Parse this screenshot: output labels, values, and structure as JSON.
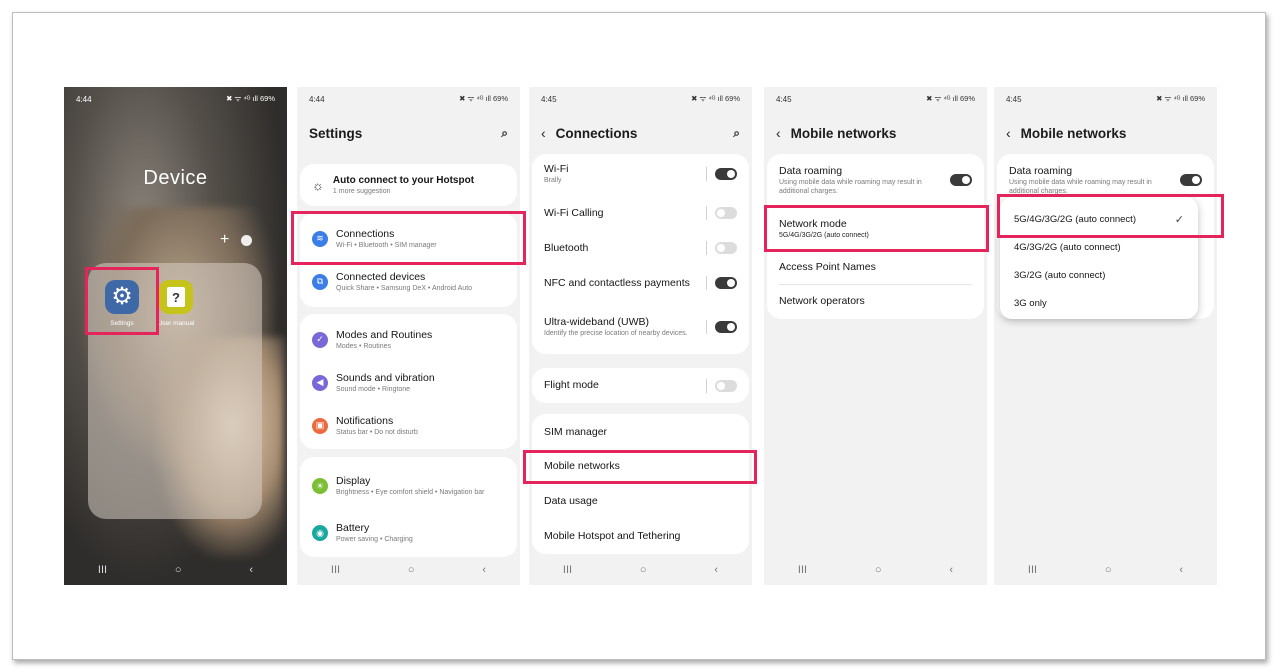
{
  "phone1": {
    "time": "4:44",
    "status_icons": "✖ ᯤ ⁴ᴳ ıll 69%",
    "folder_title": "Device",
    "add": "+",
    "apps": [
      {
        "label": "Settings",
        "icon": "gear-icon",
        "glyph": "⚙"
      },
      {
        "label": "User manual",
        "icon": "question-icon",
        "glyph": "?"
      }
    ]
  },
  "phone2": {
    "time": "4:44",
    "status_icons": "✖ ᯤ ⁴ᴳ ıll 69%",
    "title": "Settings",
    "search_glyph": "⌕",
    "suggestion": {
      "title": "Auto connect to your Hotspot",
      "subtitle": "1 more suggestion",
      "glyph": "☼"
    },
    "items": [
      {
        "title": "Connections",
        "subtitle": "Wi-Fi  •  Bluetooth  •  SIM manager",
        "color": "#3b7ee8",
        "glyph": "≋"
      },
      {
        "title": "Connected devices",
        "subtitle": "Quick Share  •  Samsung DeX  •  Android Auto",
        "color": "#3b7ee8",
        "glyph": "⧉"
      },
      {
        "title": "Modes and Routines",
        "subtitle": "Modes  •  Routines",
        "color": "#7b68d8",
        "glyph": "✓"
      },
      {
        "title": "Sounds and vibration",
        "subtitle": "Sound mode  •  Ringtone",
        "color": "#7b68d8",
        "glyph": "◀"
      },
      {
        "title": "Notifications",
        "subtitle": "Status bar  •  Do not disturb",
        "color": "#ec6a3e",
        "glyph": "▣"
      },
      {
        "title": "Display",
        "subtitle": "Brightness  •  Eye comfort shield  •  Navigation bar",
        "color": "#7bbf35",
        "glyph": "☀"
      },
      {
        "title": "Battery",
        "subtitle": "Power saving  •  Charging",
        "color": "#19a8a0",
        "glyph": "◉"
      }
    ]
  },
  "phone3": {
    "time": "4:45",
    "status_icons": "✖ ᯤ ⁴ᴳ ıll 69%",
    "title": "Connections",
    "back_glyph": "‹",
    "search_glyph": "⌕",
    "wifi": {
      "title": "Wi-Fi",
      "subtitle": "Brally"
    },
    "wifi_calling": "Wi-Fi Calling",
    "bluetooth": "Bluetooth",
    "nfc": "NFC and contactless payments",
    "uwb": {
      "title": "Ultra-wideband (UWB)",
      "subtitle": "Identify the precise location of nearby devices."
    },
    "flight": "Flight mode",
    "sim_manager": "SIM manager",
    "mobile_networks": "Mobile networks",
    "data_usage": "Data usage",
    "hotspot": "Mobile Hotspot and Tethering",
    "toggles": {
      "wifi": true,
      "wifi_calling": false,
      "bluetooth": false,
      "nfc": true,
      "uwb": true,
      "flight": false
    }
  },
  "phone4": {
    "time": "4:45",
    "status_icons": "✖ ᯤ ⁴ᴳ ıll 69%",
    "title": "Mobile networks",
    "back_glyph": "‹",
    "data_roaming": {
      "title": "Data roaming",
      "subtitle": "Using mobile data while roaming may result in additional charges."
    },
    "network_mode": {
      "title": "Network mode",
      "value": "5G/4G/3G/2G (auto connect)"
    },
    "apn": "Access Point Names",
    "operators": "Network operators"
  },
  "phone5": {
    "time": "4:45",
    "status_icons": "✖ ᯤ ⁴ᴳ ıll 69%",
    "title": "Mobile networks",
    "back_glyph": "‹",
    "data_roaming": {
      "title": "Data roaming",
      "subtitle": "Using mobile data while roaming may result in additional charges."
    },
    "options": [
      "5G/4G/3G/2G (auto connect)",
      "4G/3G/2G (auto connect)",
      "3G/2G (auto connect)",
      "3G only"
    ],
    "selected_index": 0,
    "check_glyph": "✓"
  },
  "navbar": {
    "recents": "III",
    "home": "○",
    "back": "‹"
  },
  "colors": {
    "highlight": "#e6245c",
    "background": "#f2f2f2",
    "card": "#ffffff"
  }
}
